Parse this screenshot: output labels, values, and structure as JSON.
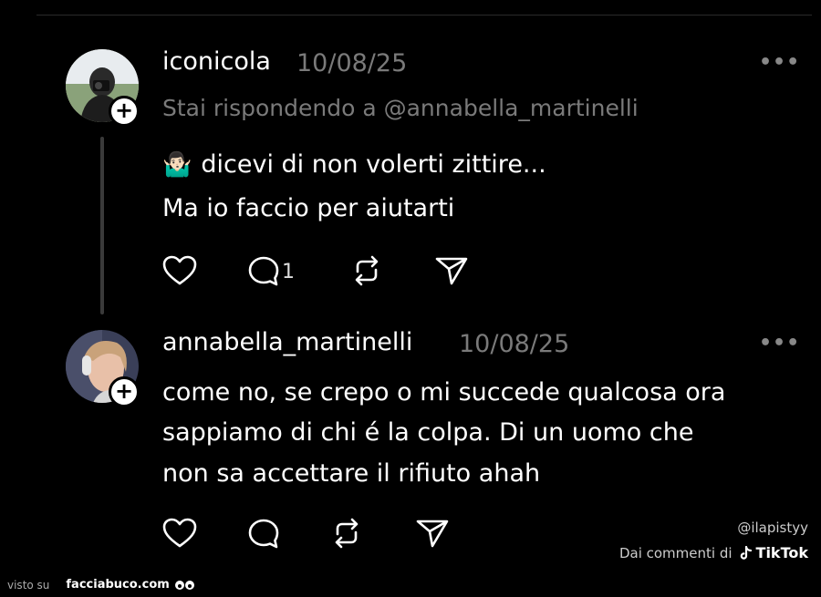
{
  "posts": [
    {
      "username": "iconicola",
      "date": "10/08/25",
      "more": "•••",
      "reply_to": "Stai rispondendo a @annabella_martinelli",
      "emoji": "🤷🏻‍♂️",
      "lines": [
        "dicevi di non volerti zittire...",
        "Ma io faccio per aiutarti"
      ],
      "reply_count": "1"
    },
    {
      "username": "annabella_martinelli",
      "date": "10/08/25",
      "more": "•••",
      "lines": [
        "come no, se crepo o mi succede qualcosa ora",
        "sappiamo di chi é la colpa. Di un uomo che",
        "non sa accettare il rifiuto ahah"
      ]
    }
  ],
  "avatar_plus": "+",
  "watermark": {
    "handle": "@ilapistyy",
    "source_prefix": "Dai commenti di",
    "source_brand": "TikTok"
  },
  "footer": {
    "seen_on": "visto su",
    "site": "facciabuco.com"
  },
  "icons": [
    "heart-icon",
    "comment-icon",
    "repost-icon",
    "share-icon",
    "more-icon",
    "tiktok-icon"
  ]
}
